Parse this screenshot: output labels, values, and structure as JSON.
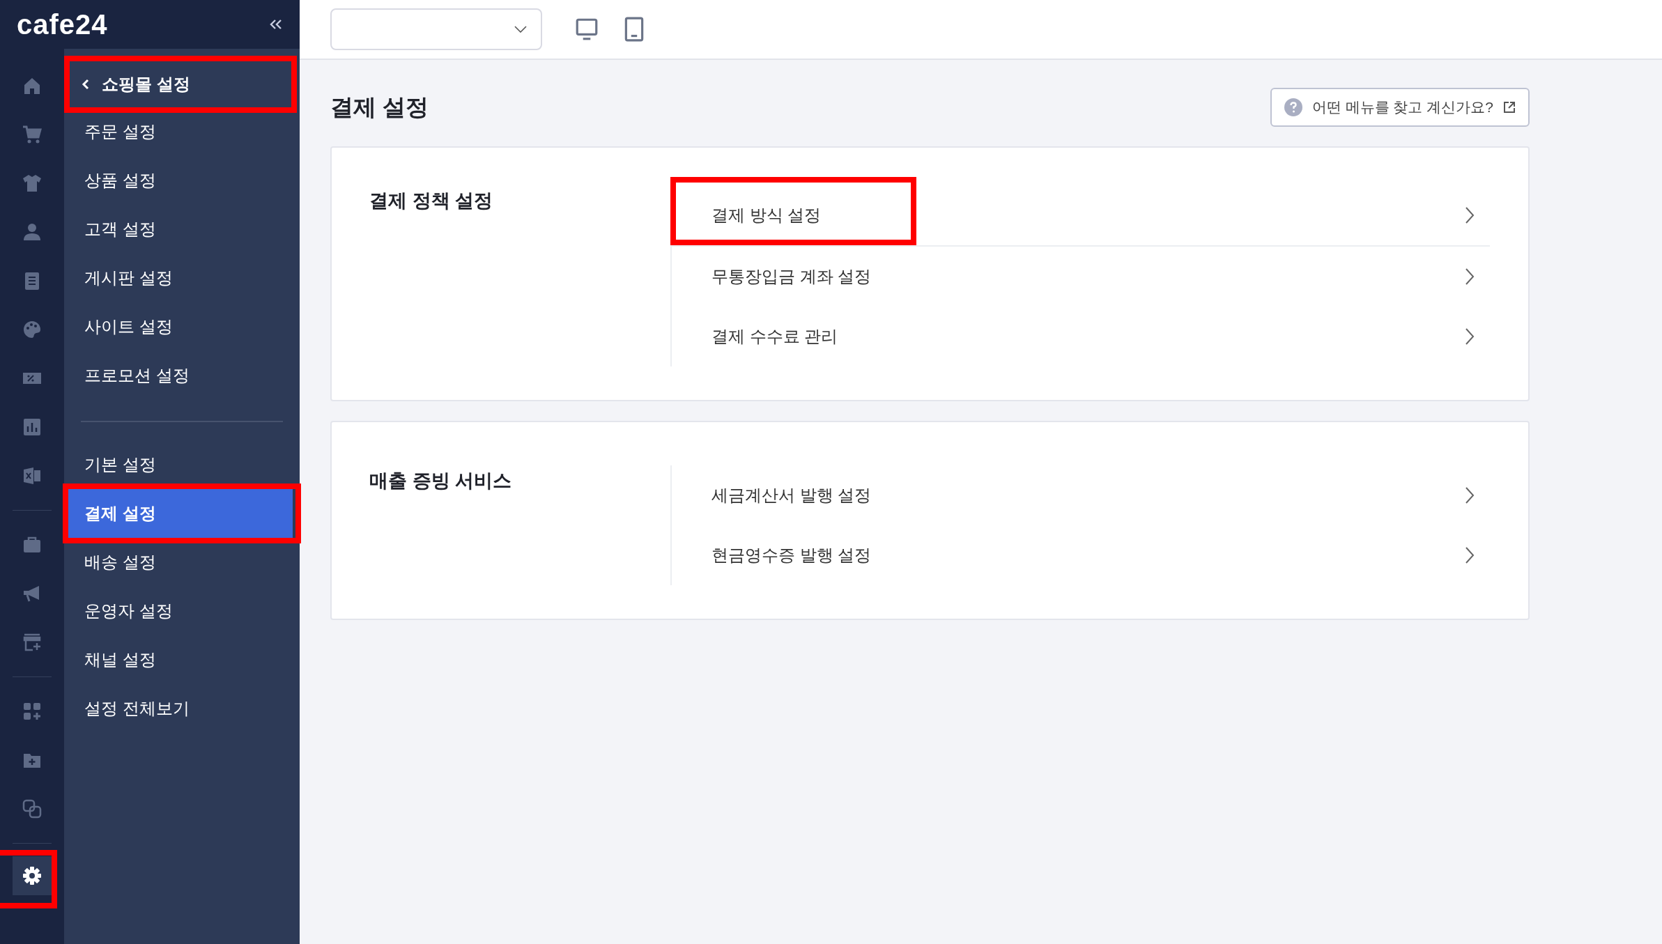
{
  "logo": "cafe24",
  "rail": [
    {
      "kind": "icon",
      "selected": false,
      "highlighted": false
    },
    {
      "kind": "icon",
      "selected": false,
      "highlighted": false
    },
    {
      "kind": "icon",
      "selected": false,
      "highlighted": false
    },
    {
      "kind": "icon",
      "selected": false,
      "highlighted": false
    },
    {
      "kind": "icon",
      "selected": false,
      "highlighted": false
    },
    {
      "kind": "icon",
      "selected": false,
      "highlighted": false
    },
    {
      "kind": "icon",
      "selected": false,
      "highlighted": false
    },
    {
      "kind": "icon",
      "selected": false,
      "highlighted": false
    },
    {
      "kind": "icon",
      "selected": false,
      "highlighted": false
    },
    {
      "kind": "divider"
    },
    {
      "kind": "icon",
      "selected": false,
      "highlighted": false
    },
    {
      "kind": "icon",
      "selected": false,
      "highlighted": false
    },
    {
      "kind": "icon",
      "selected": false,
      "highlighted": false
    },
    {
      "kind": "divider"
    },
    {
      "kind": "icon",
      "selected": false,
      "highlighted": false
    },
    {
      "kind": "icon",
      "selected": false,
      "highlighted": false
    },
    {
      "kind": "icon",
      "selected": false,
      "highlighted": false
    },
    {
      "kind": "divider"
    },
    {
      "kind": "icon",
      "selected": true,
      "highlighted": true
    }
  ],
  "sidebar": {
    "header": {
      "label": "쇼핑몰 설정",
      "highlighted": true
    },
    "groups": [
      [
        {
          "label": "주문 설정",
          "selected": false,
          "highlighted": false
        },
        {
          "label": "상품 설정",
          "selected": false,
          "highlighted": false
        },
        {
          "label": "고객 설정",
          "selected": false,
          "highlighted": false
        },
        {
          "label": "게시판 설정",
          "selected": false,
          "highlighted": false
        },
        {
          "label": "사이트 설정",
          "selected": false,
          "highlighted": false
        },
        {
          "label": "프로모션 설정",
          "selected": false,
          "highlighted": false
        }
      ],
      [
        {
          "label": "기본 설정",
          "selected": false,
          "highlighted": false
        },
        {
          "label": "결제 설정",
          "selected": true,
          "highlighted": true
        },
        {
          "label": "배송 설정",
          "selected": false,
          "highlighted": false
        },
        {
          "label": "운영자 설정",
          "selected": false,
          "highlighted": false
        },
        {
          "label": "채널 설정",
          "selected": false,
          "highlighted": false
        },
        {
          "label": "설정 전체보기",
          "selected": false,
          "highlighted": false
        }
      ]
    ]
  },
  "page_title": "결제 설정",
  "help_button": "어떤 메뉴를 찾고 계신가요?",
  "sections": [
    {
      "title": "결제 정책 설정",
      "items": [
        {
          "label": "결제 방식 설정",
          "highlighted": true
        },
        {
          "label": "무통장입금 계좌 설정",
          "highlighted": false
        },
        {
          "label": "결제 수수료 관리",
          "highlighted": false
        }
      ]
    },
    {
      "title": "매출 증빙 서비스",
      "items": [
        {
          "label": "세금계산서 발행 설정",
          "highlighted": false
        },
        {
          "label": "현금영수증 발행 설정",
          "highlighted": false
        }
      ]
    }
  ]
}
